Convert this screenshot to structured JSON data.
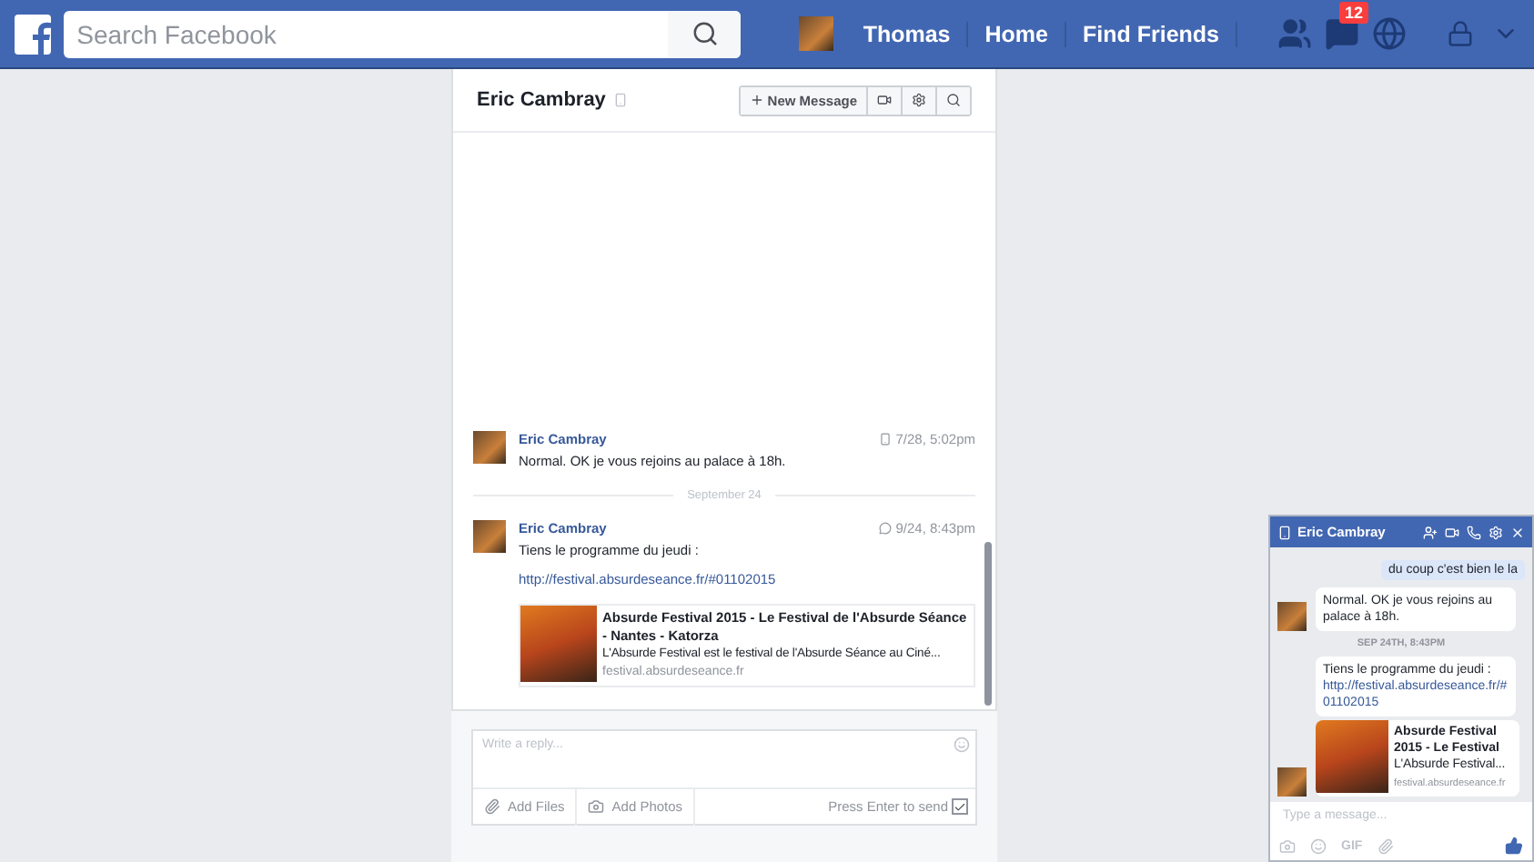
{
  "top_bar": {
    "search": {
      "placeholder": "Search Facebook"
    },
    "profile_name": "Thomas",
    "nav_links": [
      "Home",
      "Find Friends"
    ],
    "notification_count": "12"
  },
  "conversation": {
    "title": "Eric Cambray",
    "new_message_button": "New Message",
    "items": [
      {
        "kind": "message",
        "sender": "Eric Cambray",
        "time": {
          "kind": "mobile",
          "text": "7/28, 5:02pm"
        },
        "text": "Normal. OK je vous rejoins au palace à 18h."
      },
      {
        "kind": "divider",
        "label": "September 24"
      },
      {
        "kind": "message",
        "sender": "Eric Cambray",
        "time": {
          "kind": "web",
          "text": "9/24, 8:43pm"
        },
        "text": "Tiens le programme du jeudi :",
        "link": "http://festival.absurdeseance.fr/#01102015",
        "preview": {
          "title": "Absurde Festival 2015 - Le Festival de l'Absurde Séance - Nantes - Katorza",
          "description": "L'Absurde Festival est le festival de l'Absurde Séance au Ciné...",
          "domain": "festival.absurdeseance.fr"
        }
      }
    ],
    "composer": {
      "placeholder": "Write a reply...",
      "actions": [
        {
          "kind": "files",
          "label": "Add Files"
        },
        {
          "kind": "photos",
          "label": "Add Photos"
        }
      ],
      "send_on_enter": {
        "label": "Press Enter to send",
        "checked": true
      }
    }
  },
  "chat_window": {
    "title": "Eric Cambray",
    "items": [
      {
        "kind": "outgoing",
        "text": "du coup c'est bien le la"
      },
      {
        "kind": "incoming",
        "text": "Normal. OK je vous rejoins au palace à 18h."
      },
      {
        "kind": "timestamp",
        "text": "SEP 24TH, 8:43PM"
      },
      {
        "kind": "incoming",
        "text": "Tiens le programme du jeudi :",
        "link": "http://festival.absurdeseance.fr/#01102015",
        "preview": {
          "title": "Absurde Festival 2015 - Le Festival",
          "description": "L'Absurde Festival...",
          "domain": "festival.absurdeseance.fr"
        }
      }
    ],
    "placeholder": "Type a message...",
    "gif_label": "GIF"
  }
}
